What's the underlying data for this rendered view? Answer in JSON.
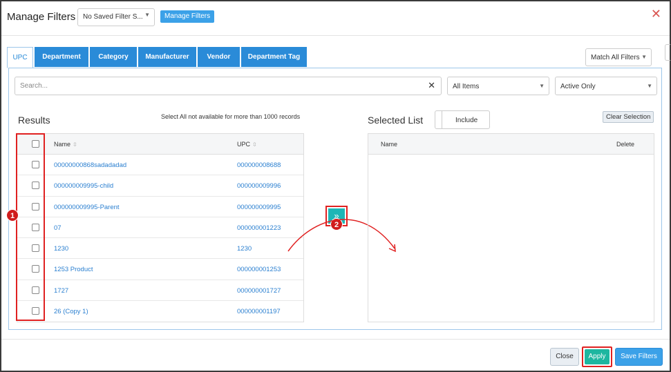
{
  "header": {
    "title": "Manage Filters",
    "saved_filter_value": "No Saved Filter S...",
    "manage_filters_label": "Manage Filters",
    "close_symbol": "✕"
  },
  "tabs": [
    {
      "label": "UPC",
      "active": true
    },
    {
      "label": "Department",
      "active": false
    },
    {
      "label": "Category",
      "active": false
    },
    {
      "label": "Manufacturer",
      "active": false
    },
    {
      "label": "Vendor",
      "active": false
    },
    {
      "label": "Department Tag",
      "active": false
    }
  ],
  "match_select_value": "Match All Filters",
  "search": {
    "placeholder": "Search...",
    "clear_symbol": "✕"
  },
  "filters": {
    "items_value": "All Items",
    "status_value": "Active Only"
  },
  "results": {
    "heading": "Results",
    "note": "Select All not available for more than 1000 records",
    "col_name": "Name",
    "col_upc": "UPC",
    "rows": [
      {
        "name": "00000000868sadadadad",
        "upc": "000000008688"
      },
      {
        "name": "000000009995-child",
        "upc": "000000009996"
      },
      {
        "name": "000000009995-Parent",
        "upc": "000000009995"
      },
      {
        "name": "07",
        "upc": "000000001223"
      },
      {
        "name": "1230",
        "upc": "1230"
      },
      {
        "name": "1253 Product",
        "upc": "000000001253"
      },
      {
        "name": "1727",
        "upc": "000000001727"
      },
      {
        "name": "26 (Copy 1)",
        "upc": "000000001197"
      }
    ]
  },
  "move_button_symbol": "»",
  "selected": {
    "heading": "Selected List",
    "include_label": "Include",
    "clear_label": "Clear Selection",
    "col_name": "Name",
    "col_delete": "Delete"
  },
  "annotations": {
    "badge1": "1",
    "badge2": "2"
  },
  "footer": {
    "close_label": "Close",
    "apply_label": "Apply",
    "save_label": "Save Filters"
  },
  "colors": {
    "accent": "#2a8bd8",
    "apply": "#1db6a0",
    "highlight": "#e02020"
  }
}
